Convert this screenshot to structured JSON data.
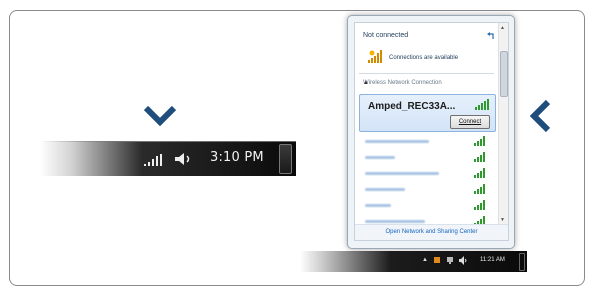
{
  "taskbar_main": {
    "time": "3:10 PM",
    "icons": [
      "wireless-signal-icon",
      "speaker-icon",
      "show-desktop-button"
    ]
  },
  "network_popup": {
    "status": "Not connected",
    "availability": "Connections are available",
    "section_header": "Wireless Network Connection",
    "selected_network": {
      "name": "Amped_REC33A...",
      "connect_label": "Connect"
    },
    "other_networks_count": 7,
    "footer_link": "Open Network and Sharing Center"
  },
  "taskbar_small": {
    "time": "11:21 AM",
    "tray_arrow": "▲"
  },
  "colors": {
    "chevron": "#1f4e7c",
    "link": "#1565c0",
    "signal_green": "#2e9a2e"
  }
}
